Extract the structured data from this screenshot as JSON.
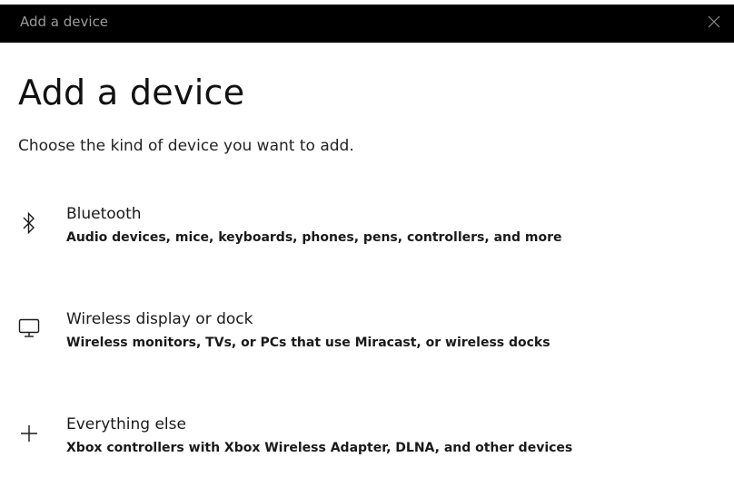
{
  "window": {
    "title": "Add a device",
    "close_icon": "close-icon"
  },
  "page": {
    "title": "Add a device",
    "subtitle": "Choose the kind of device you want to add."
  },
  "options": [
    {
      "icon": "bluetooth-icon",
      "label": "Bluetooth",
      "description": "Audio devices, mice, keyboards, phones, pens, controllers, and more"
    },
    {
      "icon": "monitor-icon",
      "label": "Wireless display or dock",
      "description": "Wireless monitors, TVs, or PCs that use Miracast, or wireless docks"
    },
    {
      "icon": "plus-icon",
      "label": "Everything else",
      "description": "Xbox controllers with Xbox Wireless Adapter, DLNA, and other devices"
    }
  ],
  "colors": {
    "titlebar_bg": "#000000",
    "titlebar_text": "#9a9a9a",
    "text": "#1a1a1a",
    "background": "#ffffff"
  }
}
